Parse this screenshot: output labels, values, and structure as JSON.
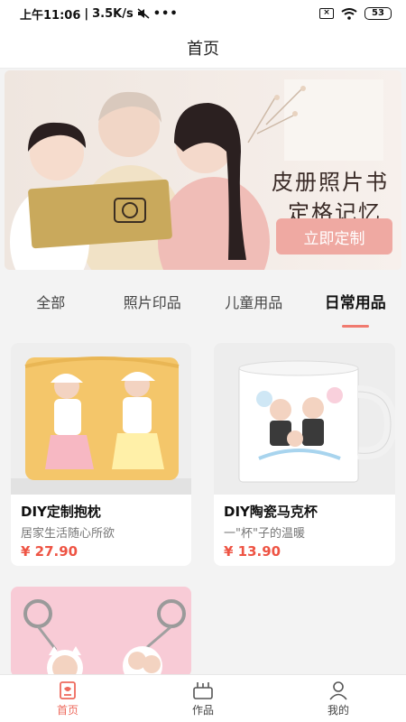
{
  "status_bar": {
    "time": "上午11:06",
    "speed": "3.5K/s",
    "more": "•••",
    "battery": "53"
  },
  "nav": {
    "title": "首页"
  },
  "banner": {
    "title_line1": "皮册照片书",
    "title_line2": "定格记忆",
    "cta": "立即定制"
  },
  "categories": [
    {
      "label": "全部",
      "active": false
    },
    {
      "label": "照片印品",
      "active": false
    },
    {
      "label": "儿童用品",
      "active": false
    },
    {
      "label": "日常用品",
      "active": true
    }
  ],
  "products": [
    {
      "name": "DIY定制抱枕",
      "desc": "居家生活随心所欲",
      "price": "¥ 27.90"
    },
    {
      "name": "DIY陶瓷马克杯",
      "desc": "一\"杯\"子的温暖",
      "price": "¥ 13.90"
    },
    {
      "name": "",
      "desc": "",
      "price": ""
    }
  ],
  "tab_bar": [
    {
      "label": "首页",
      "icon": "home-icon",
      "active": true
    },
    {
      "label": "作品",
      "icon": "works-icon",
      "active": false
    },
    {
      "label": "我的",
      "icon": "user-icon",
      "active": false
    }
  ],
  "colors": {
    "accent": "#ee6a5d",
    "price": "#ee5444",
    "cta": "#efa9a2"
  }
}
